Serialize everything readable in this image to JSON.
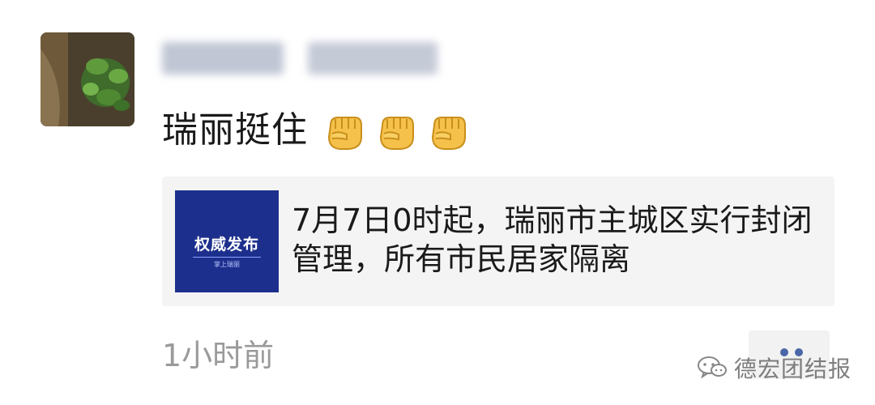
{
  "post": {
    "text": "瑞丽挺住",
    "emoji": [
      "fist-emoji",
      "fist-emoji",
      "fist-emoji"
    ]
  },
  "shared_link": {
    "thumbnail_title": "权威发布",
    "thumbnail_sub": "掌上瑞丽",
    "headline": "7月7日0时起，瑞丽市主城区实行封闭管理，所有市民居家隔离"
  },
  "meta": {
    "time": "1小时前"
  },
  "watermark": {
    "text": "德宏团结报"
  },
  "colors": {
    "thumbnail_bg": "#1d2f8c",
    "card_bg": "#f4f4f4",
    "time_gray": "#9a9a9a",
    "dots_blue": "#4a67a8"
  }
}
